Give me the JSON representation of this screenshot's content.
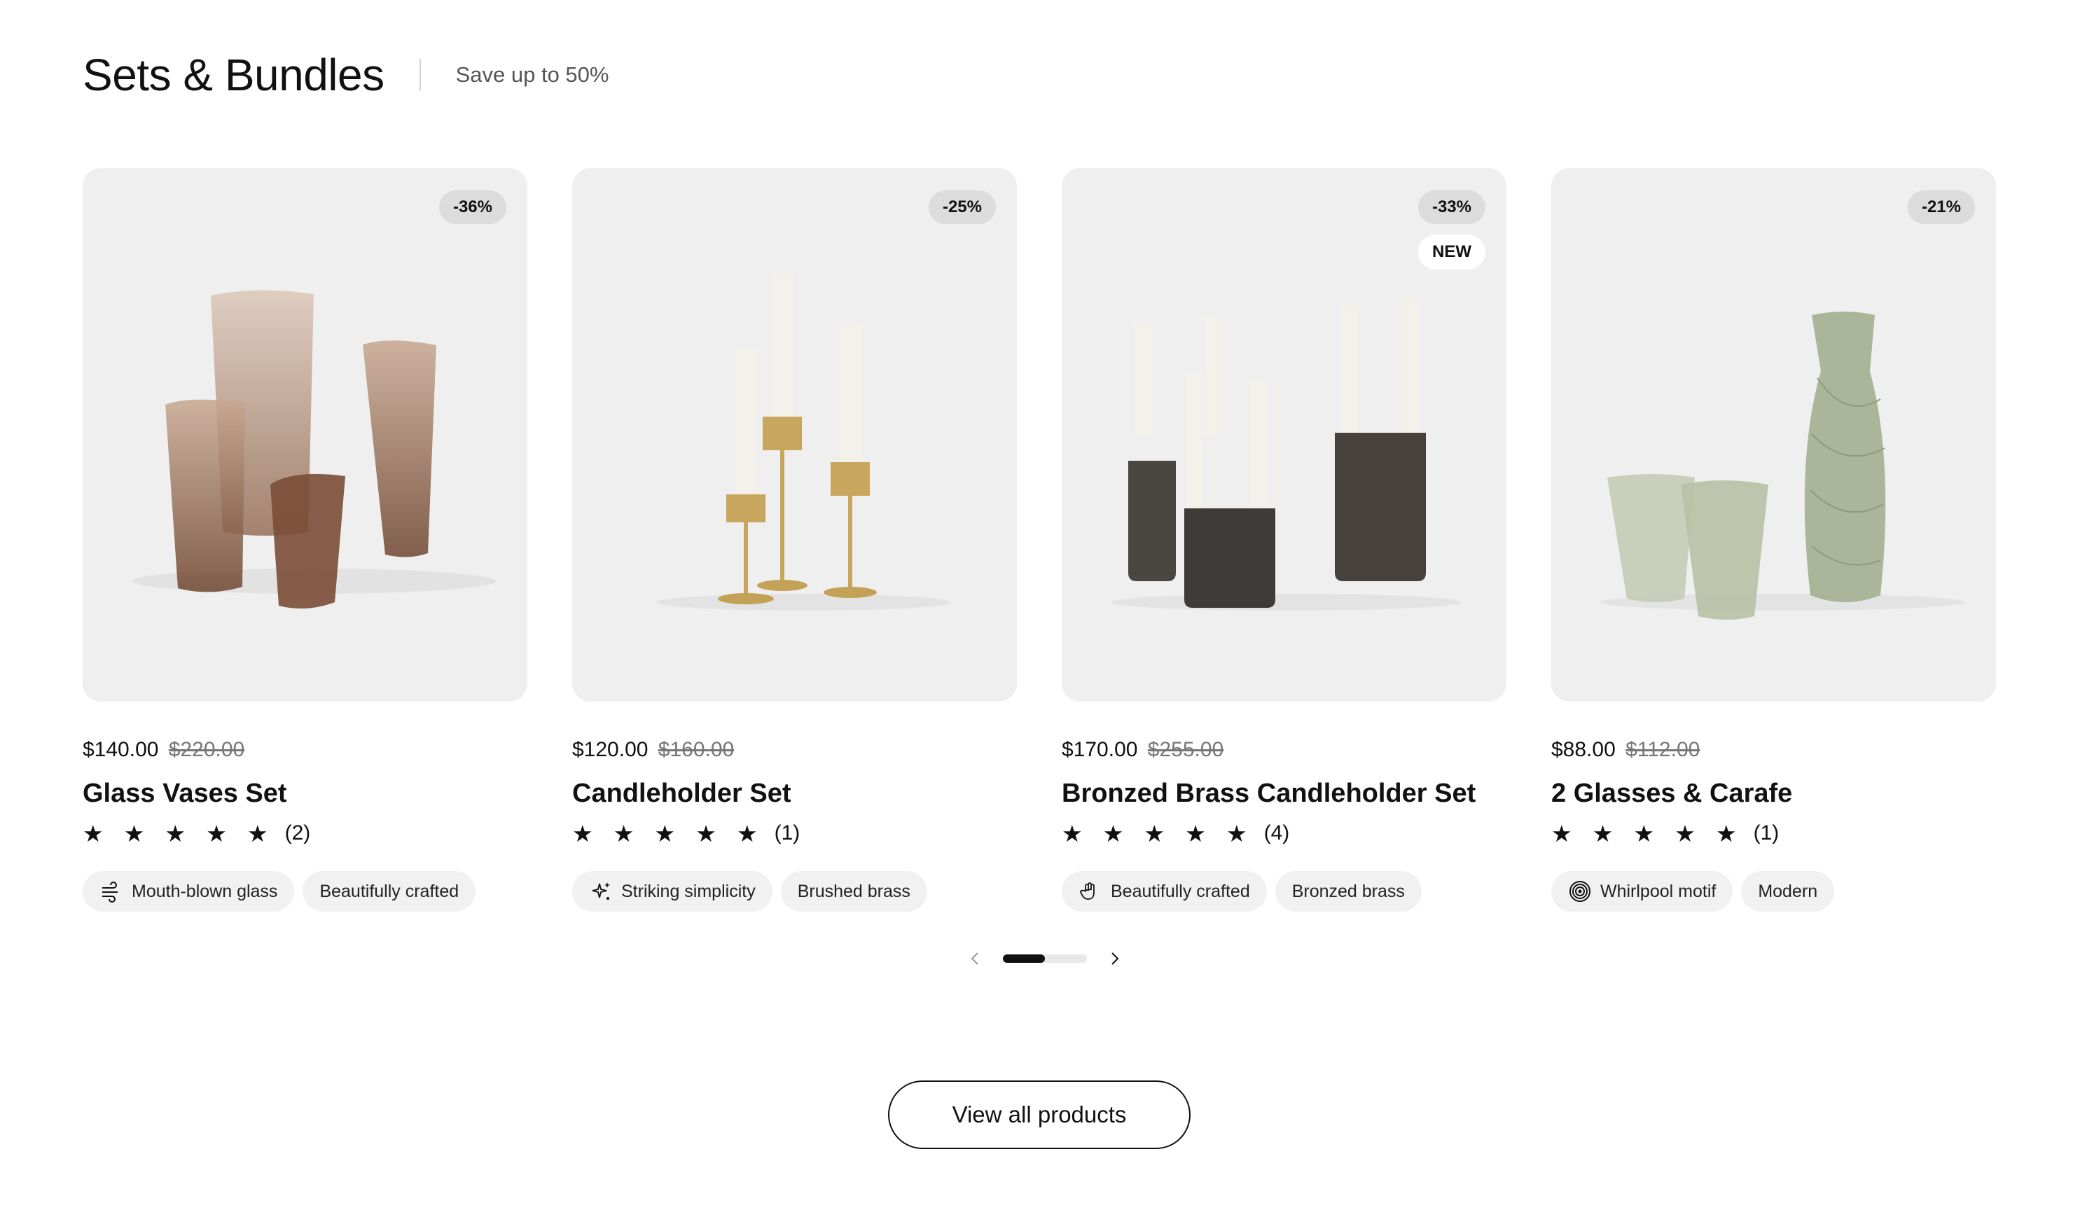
{
  "section": {
    "title": "Sets & Bundles",
    "subtitle": "Save up to 50%"
  },
  "products": [
    {
      "discount": "-36%",
      "price": "$140.00",
      "old_price": "$220.00",
      "name": "Glass Vases Set",
      "stars": "★ ★ ★ ★ ★",
      "rating_value": 5,
      "review_count": "(2)",
      "tags": [
        {
          "label": "Mouth-blown glass",
          "icon": "wind-icon"
        },
        {
          "label": "Beautifully crafted",
          "icon": ""
        }
      ]
    },
    {
      "discount": "-25%",
      "price": "$120.00",
      "old_price": "$160.00",
      "name": "Candleholder Set",
      "stars": "★ ★ ★ ★ ★",
      "rating_value": 5,
      "review_count": "(1)",
      "tags": [
        {
          "label": "Striking simplicity",
          "icon": "sparkle-icon"
        },
        {
          "label": "Brushed brass",
          "icon": ""
        }
      ]
    },
    {
      "discount": "-33%",
      "new_badge": "NEW",
      "price": "$170.00",
      "old_price": "$255.00",
      "name": "Bronzed Brass Candleholder Set",
      "stars": "★ ★ ★ ★ ★",
      "rating_value": 5,
      "review_count": "(4)",
      "tags": [
        {
          "label": "Beautifully crafted",
          "icon": "hand-icon"
        },
        {
          "label": "Bronzed brass",
          "icon": ""
        }
      ]
    },
    {
      "discount": "-21%",
      "price": "$88.00",
      "old_price": "$112.00",
      "name": "2 Glasses & Carafe",
      "stars": "★ ★ ★ ★ ★",
      "rating_value": 5,
      "review_count": "(1)",
      "tags": [
        {
          "label": "Whirlpool motif",
          "icon": "spiral-icon"
        },
        {
          "label": "Modern",
          "icon": ""
        }
      ]
    }
  ],
  "pager": {
    "prev_icon": "chevron-left-icon",
    "next_icon": "chevron-right-icon",
    "progress": 0.5
  },
  "cta": {
    "label": "View all products"
  }
}
